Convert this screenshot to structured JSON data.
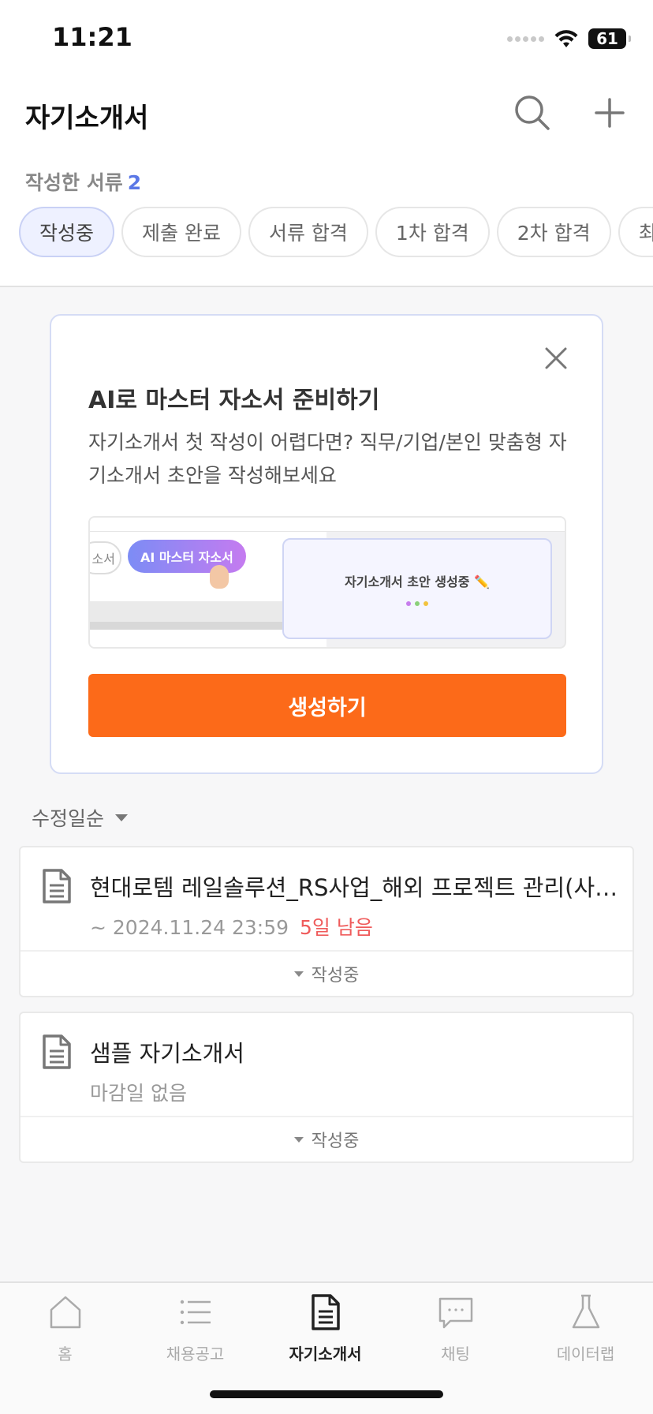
{
  "status_bar": {
    "time": "11:21",
    "battery": "61",
    "icons": [
      "cellular-icon",
      "wifi-icon",
      "battery-icon"
    ]
  },
  "header": {
    "title": "자기소개서",
    "icons": [
      "search-icon",
      "plus-icon"
    ]
  },
  "documents_count": {
    "label": "작성한 서류",
    "count": "2"
  },
  "filters": [
    {
      "label": "작성중",
      "active": true
    },
    {
      "label": "제출 완료"
    },
    {
      "label": "서류 합격"
    },
    {
      "label": "1차 합격"
    },
    {
      "label": "2차 합격"
    },
    {
      "label": "최종 합격"
    }
  ],
  "promo": {
    "title": "AI로 마스터 자소서 준비하기",
    "description": "자기소개서 첫 작성이 어렵다면? 직무/기업/본인 맞춤형 자기소개서 초안을 작성해보세요",
    "preview": {
      "prev_pill": "소서",
      "ai_pill": "AI 마스터 자소서",
      "modal_text": "자기소개서 초안 생성중 ✏️",
      "dot_colors": [
        "#c77ded",
        "#8bd07a",
        "#f2c33e"
      ]
    },
    "button": "생성하기",
    "close_icon": "close-icon"
  },
  "sort": {
    "label": "수정일순"
  },
  "documents": [
    {
      "title": "현대로템 레일솔루션_RS사업_해외 프로젝트 관리(사업관리)",
      "deadline": "~ 2024.11.24 23:59",
      "remaining": "5일 남음",
      "status": "작성중"
    },
    {
      "title": "샘플 자기소개서",
      "deadline": "마감일 없음",
      "remaining": "",
      "status": "작성중"
    }
  ],
  "tabbar": [
    {
      "label": "홈",
      "icon": "home-icon"
    },
    {
      "label": "채용공고",
      "icon": "list-icon"
    },
    {
      "label": "자기소개서",
      "icon": "document-icon",
      "active": true
    },
    {
      "label": "채팅",
      "icon": "chat-icon"
    },
    {
      "label": "데이터랩",
      "icon": "flask-icon"
    }
  ],
  "colors": {
    "accent_orange": "#fc6a19",
    "count_blue": "#5b78e6",
    "remaining_red": "#ef5b5b"
  }
}
